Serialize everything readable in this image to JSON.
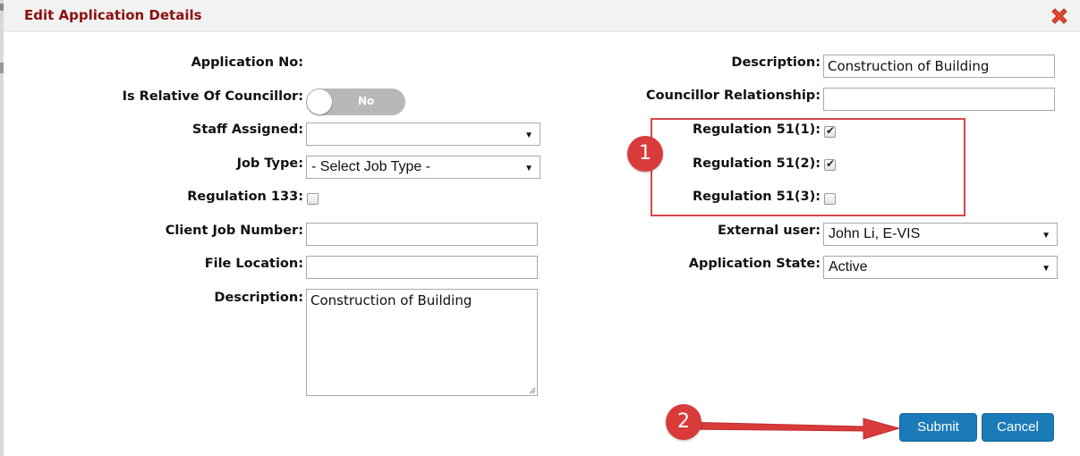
{
  "dialog": {
    "title": "Edit Application Details"
  },
  "left_column": {
    "application_no_label": "Application No:",
    "is_relative_label": "Is Relative Of Councillor:",
    "is_relative_toggle": "No",
    "staff_assigned_label": "Staff Assigned:",
    "staff_assigned_value": "",
    "job_type_label": "Job Type:",
    "job_type_value": "- Select Job Type -",
    "regulation_133_label": "Regulation 133:",
    "client_job_number_label": "Client Job Number:",
    "client_job_number_value": "",
    "file_location_label": "File Location:",
    "file_location_value": "",
    "description_label": "Description:",
    "description_value": "Construction of Building"
  },
  "right_column": {
    "description_label": "Description:",
    "description_value": "Construction of Building",
    "councillor_relationship_label": "Councillor Relationship:",
    "councillor_relationship_value": "",
    "regulation_51_1_label": "Regulation 51(1):",
    "regulation_51_2_label": "Regulation 51(2):",
    "regulation_51_3_label": "Regulation 51(3):",
    "external_user_label": "External user:",
    "external_user_value": "John Li, E-VIS",
    "application_state_label": "Application State:",
    "application_state_value": "Active"
  },
  "checkboxes": {
    "regulation_133": false,
    "regulation_51_1": true,
    "regulation_51_2": true,
    "regulation_51_3": false
  },
  "annotations": {
    "badge_1": "1",
    "badge_2": "2"
  },
  "buttons": {
    "submit": "Submit",
    "cancel": "Cancel"
  },
  "colors": {
    "title": "#8b1010",
    "primary_button": "#1b7ab8",
    "annotation_red": "#d93b3b"
  }
}
